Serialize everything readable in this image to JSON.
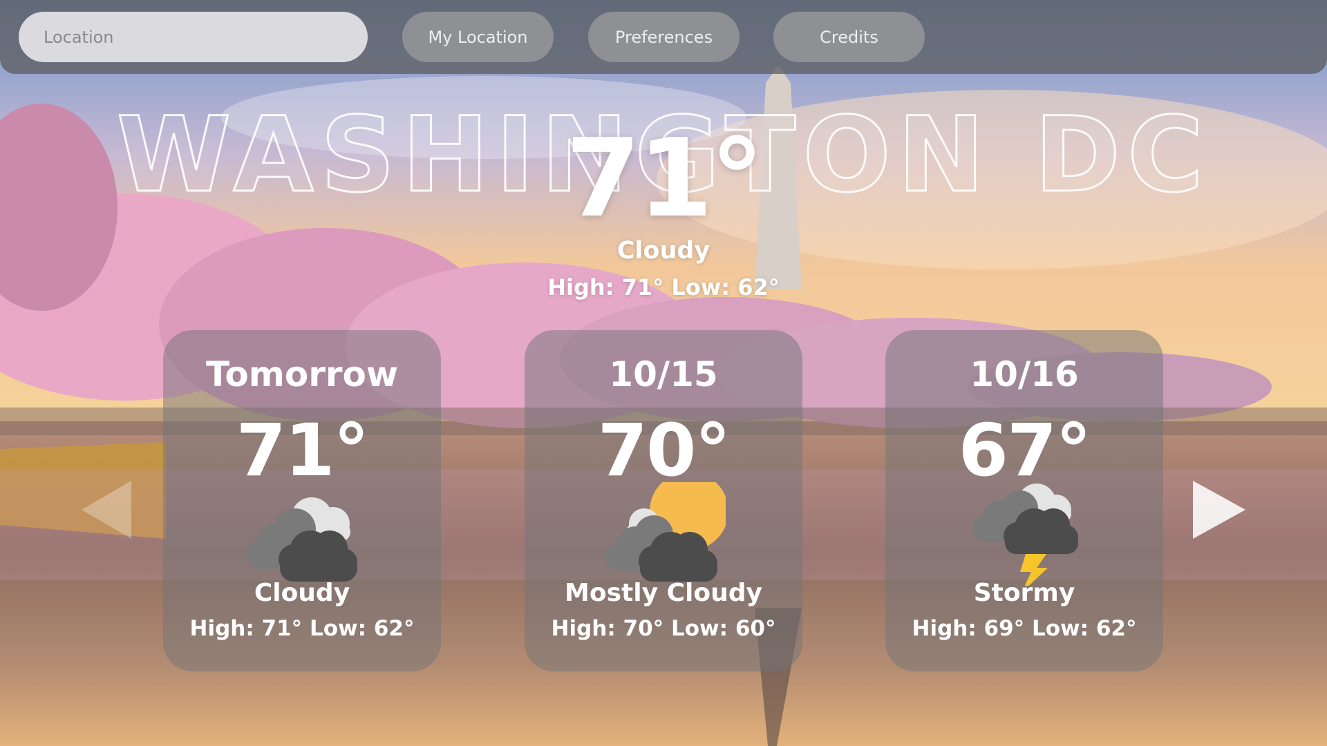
{
  "search": {
    "placeholder": "Location"
  },
  "nav": {
    "my_location": "My Location",
    "preferences": "Preferences",
    "credits": "Credits"
  },
  "current": {
    "city": "WASHINGTON DC",
    "temp": "71°",
    "condition": "Cloudy",
    "high_low": "High: 71° Low: 62°"
  },
  "forecast": [
    {
      "day": "Tomorrow",
      "temp": "71°",
      "icon": "cloudy-icon",
      "condition": "Cloudy",
      "high_low": "High: 71° Low: 62°"
    },
    {
      "day": "10/15",
      "temp": "70°",
      "icon": "partly-sunny-icon",
      "condition": "Mostly Cloudy",
      "high_low": "High: 70° Low: 60°"
    },
    {
      "day": "10/16",
      "temp": "67°",
      "icon": "storm-icon",
      "condition": "Stormy",
      "high_low": "High: 69° Low: 62°"
    }
  ],
  "colors": {
    "sun": "#f6bb4f",
    "lightning": "#f5c52a",
    "dark_cloud": "#4c4c4c",
    "card_bg": "#737378"
  }
}
